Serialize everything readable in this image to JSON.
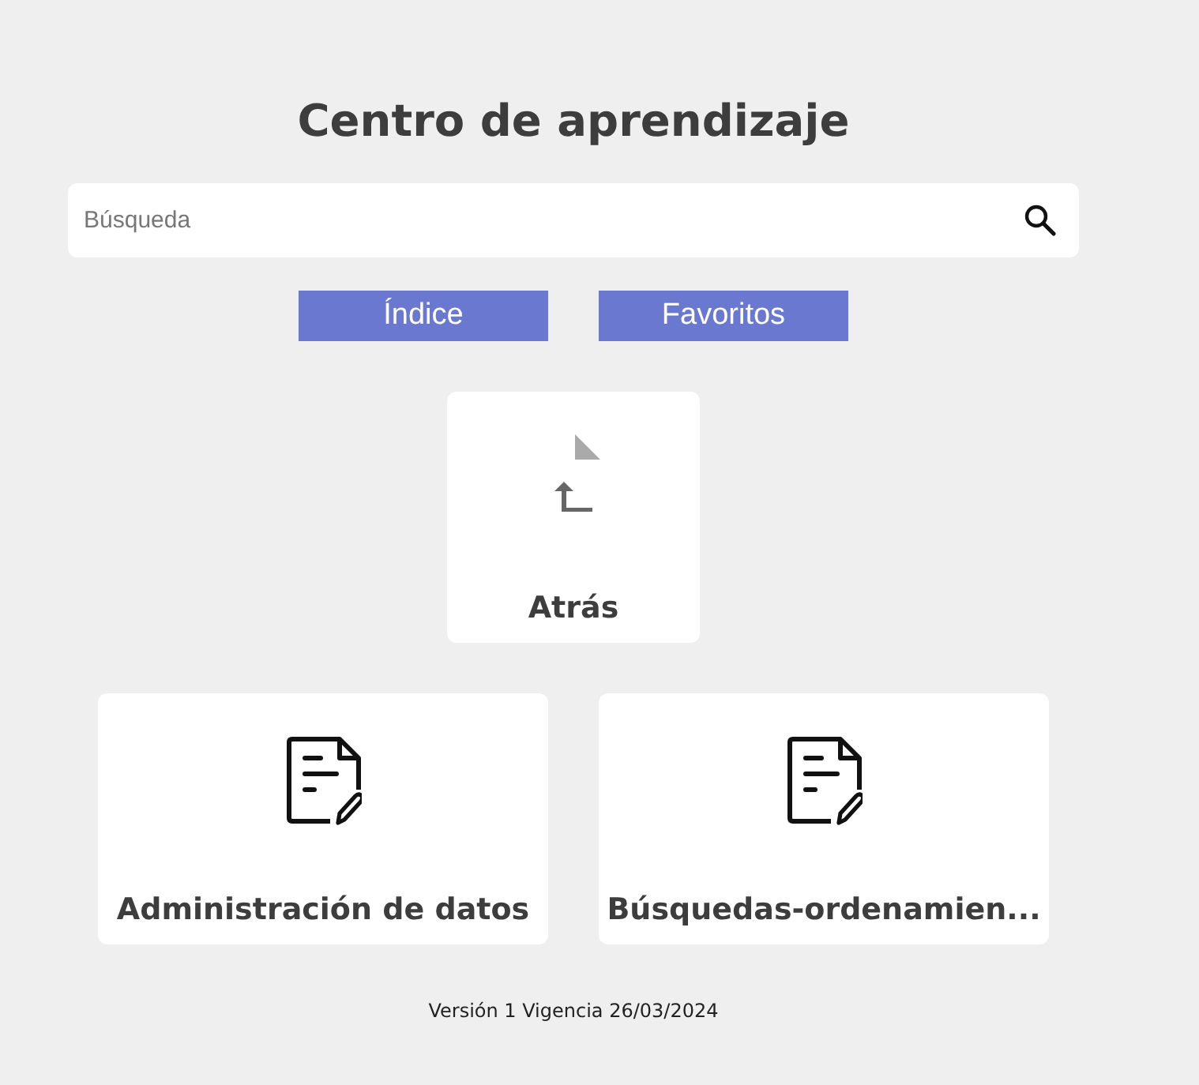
{
  "title": "Centro de aprendizaje",
  "search": {
    "placeholder": "Búsqueda"
  },
  "buttons": [
    "Índice",
    "Favoritos"
  ],
  "cards": [
    {
      "kind": "back",
      "label": "Atrás"
    },
    {
      "kind": "document",
      "label": "Administración de datos"
    },
    {
      "kind": "document",
      "label": "Búsquedas-ordenamien..."
    }
  ],
  "footer": "Versión 1 Vigencia 26/03/2024"
}
